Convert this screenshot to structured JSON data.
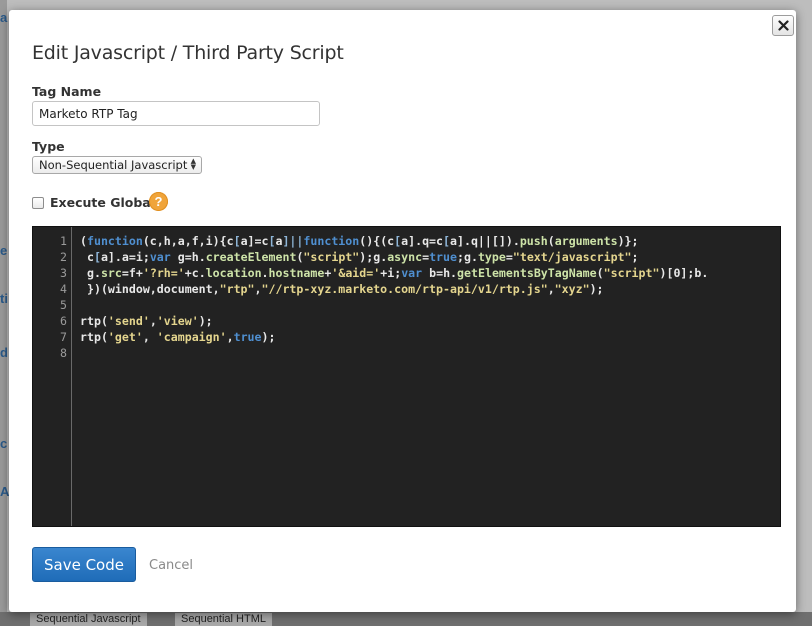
{
  "background": {
    "fragments": [
      "a",
      "e",
      "ti",
      "d",
      "c",
      "A"
    ],
    "bottom_tabs": [
      "Sequential Javascript",
      "Sequential HTML"
    ]
  },
  "modal": {
    "title": "Edit Javascript / Third Party Script",
    "close_icon": "close-x-icon",
    "tag_name_label": "Tag Name",
    "tag_name_value": "Marketo RTP Tag",
    "type_label": "Type",
    "type_selected": "Non-Sequential Javascript",
    "execute_globally_label": "Execute Globally",
    "execute_globally_checked": false,
    "help_icon_text": "?",
    "save_label": "Save Code",
    "cancel_label": "Cancel"
  },
  "editor": {
    "line_numbers": [
      "1",
      "2",
      "3",
      "4",
      "5",
      "6",
      "7",
      "8"
    ],
    "lines": [
      "(function(c,h,a,f,i){c[a]=c[a]||function(){(c[a].q=c[a].q||[]).push(arguments)};",
      " c[a].a=i;var g=h.createElement(\"script\");g.async=true;g.type=\"text/javascript\";",
      " g.src=f+'?rh='+c.location.hostname+'&aid='+i;var b=h.getElementsByTagName(\"script\")[0];b.",
      " })(window,document,\"rtp\",\"//rtp-xyz.marketo.com/rtp-api/v1/rtp.js\",\"xyz\");",
      "",
      "rtp('send','view');",
      "rtp('get', 'campaign',true);",
      ""
    ]
  },
  "colors": {
    "editor_bg": "#222222",
    "primary_button": "#2a78c4",
    "help_icon": "#f0a43a"
  }
}
